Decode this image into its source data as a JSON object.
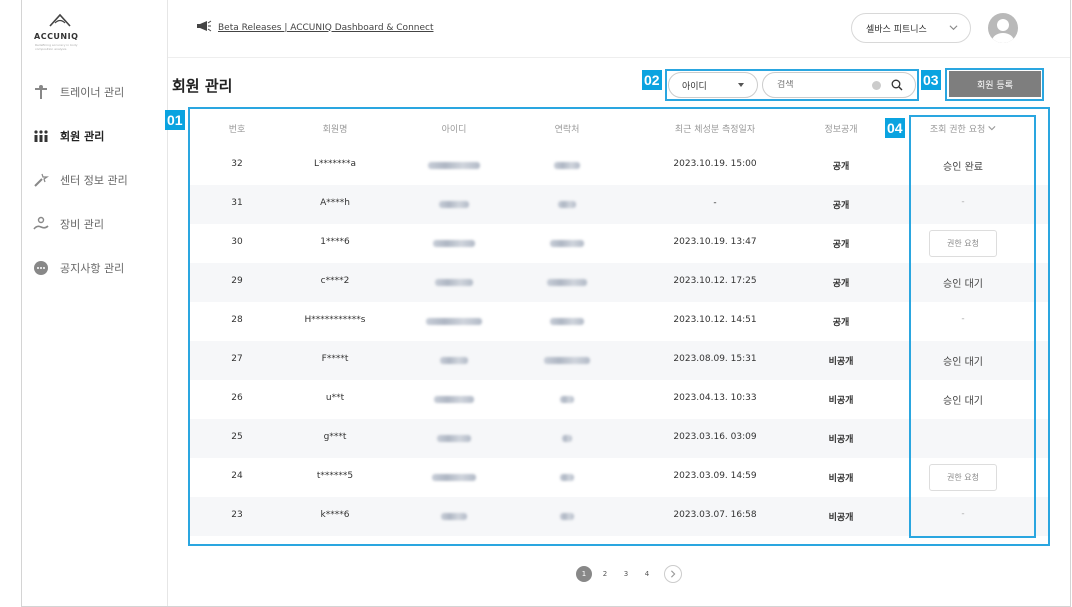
{
  "brand": {
    "logo_text": "ACCUNIQ",
    "logo_sub": "Redefining accuracy in body composition analysis"
  },
  "sidebar": {
    "items": [
      {
        "label": "트레이너 관리",
        "icon": "trainer-icon",
        "active": false
      },
      {
        "label": "회원 관리",
        "icon": "members-icon",
        "active": true
      },
      {
        "label": "센터 정보 관리",
        "icon": "center-info-icon",
        "active": false
      },
      {
        "label": "장비 관리",
        "icon": "equipment-icon",
        "active": false
      },
      {
        "label": "공지사항 관리",
        "icon": "notice-icon",
        "active": false
      }
    ]
  },
  "header": {
    "announcement": "Beta Releases | ACCUNIQ Dashboard & Connect",
    "org_name": "셀바스 피트니스"
  },
  "page": {
    "title": "회원 관리"
  },
  "badges": {
    "table": "01",
    "search": "02",
    "register": "03",
    "permission": "04"
  },
  "search": {
    "field_select": "아이디",
    "placeholder": "검색"
  },
  "register_label": "회원 등록",
  "table": {
    "columns": [
      "번호",
      "회원명",
      "아이디",
      "연락처",
      "최근 체성분 측정일자",
      "정보공개",
      "조회 권한 요청"
    ],
    "rows": [
      {
        "no": "32",
        "name": "L*******a",
        "date": "2023.10.19. 15:00",
        "disclosure": "공개",
        "permission": "승인 완료",
        "permission_type": "status"
      },
      {
        "no": "31",
        "name": "A****h",
        "date": "-",
        "disclosure": "공개",
        "permission": "-",
        "permission_type": "dash"
      },
      {
        "no": "30",
        "name": "1****6",
        "date": "2023.10.19. 13:47",
        "disclosure": "공개",
        "permission": "권한 요청",
        "permission_type": "button"
      },
      {
        "no": "29",
        "name": "c****2",
        "date": "2023.10.12. 17:25",
        "disclosure": "공개",
        "permission": "승인 대기",
        "permission_type": "status"
      },
      {
        "no": "28",
        "name": "H***********s",
        "date": "2023.10.12. 14:51",
        "disclosure": "공개",
        "permission": "-",
        "permission_type": "dash"
      },
      {
        "no": "27",
        "name": "F****t",
        "date": "2023.08.09. 15:31",
        "disclosure": "비공개",
        "permission": "승인 대기",
        "permission_type": "status"
      },
      {
        "no": "26",
        "name": "u**t",
        "date": "2023.04.13. 10:33",
        "disclosure": "비공개",
        "permission": "승인 대기",
        "permission_type": "status"
      },
      {
        "no": "25",
        "name": "g***t",
        "date": "2023.03.16. 03:09",
        "disclosure": "비공개",
        "permission": "",
        "permission_type": "empty"
      },
      {
        "no": "24",
        "name": "t******5",
        "date": "2023.03.09. 14:59",
        "disclosure": "비공개",
        "permission": "권한 요청",
        "permission_type": "button"
      },
      {
        "no": "23",
        "name": "k****6",
        "date": "2023.03.07. 16:58",
        "disclosure": "비공개",
        "permission": "-",
        "permission_type": "dash"
      }
    ]
  },
  "pagination": {
    "pages": [
      "1",
      "2",
      "3",
      "4"
    ],
    "current": "1"
  },
  "colors": {
    "highlight": "#2aa6e0",
    "badge": "#0aa3e0",
    "button": "#7e7e7e"
  }
}
